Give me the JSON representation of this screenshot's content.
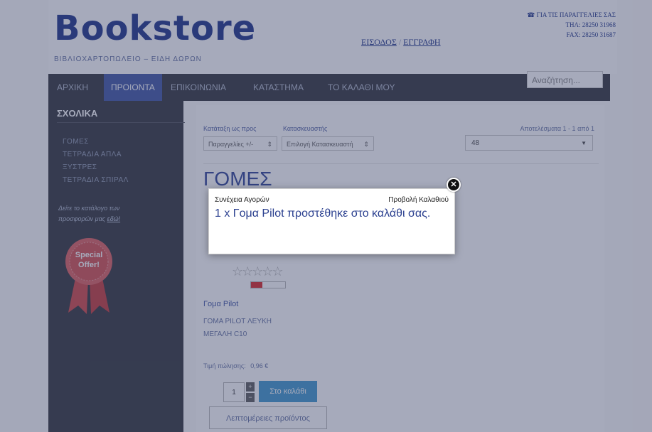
{
  "header": {
    "logo": "Bookstore",
    "tagline": "ΒΙΒΛΙΟΧΑΡΤΟΠΩΛΕΙΟ – ΕΙΔΗ ΔΩΡΩΝ",
    "login": "ΕΙΣΟΔΟΣ",
    "separator": "/",
    "register": "ΕΓΓΡΑΦΗ",
    "contact_title": "ΓΙΑ ΤΙΣ ΠΑΡΑΓΓΕΛΙΕΣ ΣΑΣ",
    "phone": "ΤΗΛ: 28250 31968",
    "fax": "FAX: 28250 31687"
  },
  "nav": {
    "items": [
      "ΑΡΧΙΚΗ",
      "ΠΡΟΙΟΝΤΑ",
      "ΕΠΙΚΟΙΝΩΝΙΑ",
      "ΚΑΤΑΣΤΗΜΑ",
      "ΤΟ ΚΑΛΑΘΙ ΜΟΥ"
    ],
    "search_placeholder": "Αναζήτηση..."
  },
  "sidebar": {
    "title": "ΣΧΟΛΙΚΑ",
    "items": [
      "ΓΟΜΕΣ",
      "ΤΕΤΡΑΔΙΑ ΑΠΛΑ",
      "ΞΥΣΤΡΕΣ",
      "ΤΕΤΡΑΔΙΑ ΣΠΙΡΑΛ"
    ],
    "catalog_text": "Δείτε το κατάλογο των προσφορών μας",
    "catalog_link": "εδώ!",
    "ribbon_line1": "Special",
    "ribbon_line2": "Offer!"
  },
  "main": {
    "sort_label": "Κατάταξη ως προς",
    "sort_value": "Παραγγελίες +/-",
    "maker_label": "Κατασκευαστής",
    "maker_value": "Επιλογή Κατασκευαστή",
    "results": "Αποτελέσματα 1 - 1 από 1",
    "perpage": "48",
    "category_title": "ΓΟΜΕΣ"
  },
  "product": {
    "name": "Γομα Pilot",
    "description": "ΓΟΜΑ PILOT ΛΕΥΚΗ ΜΕΓΑΛΗ C10",
    "price_label": "Τιμή πώλησης:",
    "price_value": "0,96 €",
    "qty": "1",
    "cart_button": "Στο καλάθι",
    "details_button": "Λεπτομέρειες προϊόντος",
    "stock_level": 0.33,
    "stars": "☆☆☆☆☆"
  },
  "modal": {
    "continue_label": "Συνέχεια Αγορών",
    "view_cart_label": "Προβολή Καλαθιού",
    "message": "1 x Γομα Pilot προστέθηκε στο καλάθι σας.",
    "close_symbol": "✕"
  },
  "colors": {
    "brand": "#2a3f8f",
    "nav_bg": "#3e4148",
    "nav_active": "#4a5faa",
    "cart_button": "#4b9ed0"
  }
}
